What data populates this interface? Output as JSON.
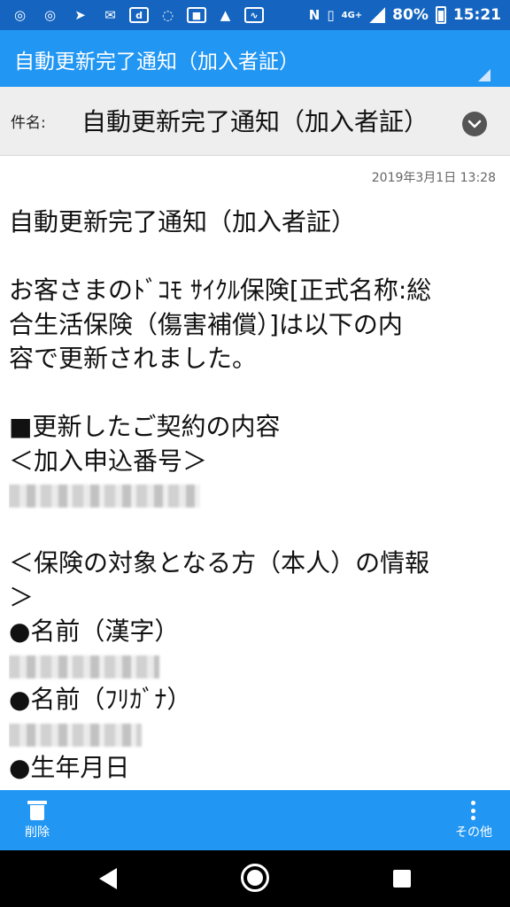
{
  "status_bar": {
    "icons": [
      "app-icon-1",
      "app-icon-2",
      "app-icon-3",
      "mail-icon",
      "docomo-icon",
      "app-icon-on",
      "app-icon-box",
      "app-icon-run",
      "activity-icon"
    ],
    "nfc": "N",
    "network": "4G+",
    "battery": "80%",
    "time": "15:21"
  },
  "title_bar": {
    "title": "自動更新完了通知（加入者証）"
  },
  "subject": {
    "label": "件名:",
    "value": "自動更新完了通知（加入者証）"
  },
  "message": {
    "date": "2019年3月1日 13:28",
    "lines": {
      "title": "自動更新完了通知（加入者証）",
      "intro1": "お客さまのﾄﾞｺﾓ ｻｲｸﾙ保険[正式名称:総",
      "intro2": "合生活保険（傷害補償）]は以下の内",
      "intro3": "容で更新されました。",
      "section": "■更新したご契約の内容",
      "app_no": "＜加入申込番号＞",
      "insured1": "＜保険の対象となる方（本人）の情報",
      "insured2": "＞",
      "name_kanji": "●名前（漢字）",
      "name_kana": "●名前（ﾌﾘｶﾞﾅ）",
      "birth": "●生年月日"
    }
  },
  "toolbar": {
    "delete_label": "削除",
    "more_label": "その他"
  },
  "colors": {
    "status_bar": "#1565c0",
    "app_bar": "#2196f3",
    "subject_bg": "#eeeeee",
    "nav_bar": "#000000"
  }
}
